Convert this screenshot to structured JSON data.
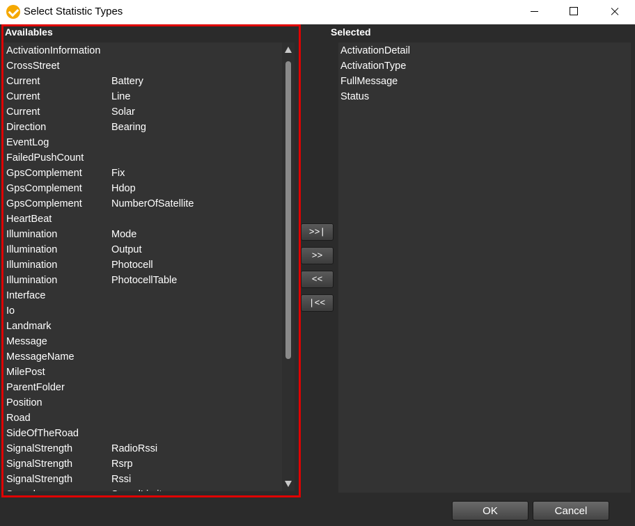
{
  "window": {
    "title": "Select Statistic Types"
  },
  "availables": {
    "label": "Availables",
    "items": [
      {
        "c1": "ActivationInformation",
        "c2": ""
      },
      {
        "c1": "CrossStreet",
        "c2": ""
      },
      {
        "c1": "Current",
        "c2": "Battery"
      },
      {
        "c1": "Current",
        "c2": "Line"
      },
      {
        "c1": "Current",
        "c2": "Solar"
      },
      {
        "c1": "Direction",
        "c2": "Bearing"
      },
      {
        "c1": "EventLog",
        "c2": ""
      },
      {
        "c1": "FailedPushCount",
        "c2": ""
      },
      {
        "c1": "GpsComplement",
        "c2": "Fix"
      },
      {
        "c1": "GpsComplement",
        "c2": "Hdop"
      },
      {
        "c1": "GpsComplement",
        "c2": "NumberOfSatellite"
      },
      {
        "c1": "HeartBeat",
        "c2": ""
      },
      {
        "c1": "Illumination",
        "c2": "Mode"
      },
      {
        "c1": "Illumination",
        "c2": "Output"
      },
      {
        "c1": "Illumination",
        "c2": "Photocell"
      },
      {
        "c1": "Illumination",
        "c2": "PhotocellTable"
      },
      {
        "c1": "Interface",
        "c2": ""
      },
      {
        "c1": "Io",
        "c2": ""
      },
      {
        "c1": "Landmark",
        "c2": ""
      },
      {
        "c1": "Message",
        "c2": ""
      },
      {
        "c1": "MessageName",
        "c2": ""
      },
      {
        "c1": "MilePost",
        "c2": ""
      },
      {
        "c1": "ParentFolder",
        "c2": ""
      },
      {
        "c1": "Position",
        "c2": ""
      },
      {
        "c1": "Road",
        "c2": ""
      },
      {
        "c1": "SideOfTheRoad",
        "c2": ""
      },
      {
        "c1": "SignalStrength",
        "c2": "RadioRssi"
      },
      {
        "c1": "SignalStrength",
        "c2": "Rsrp"
      },
      {
        "c1": "SignalStrength",
        "c2": "Rssi"
      },
      {
        "c1": "Speed",
        "c2": "SpeedLimit"
      }
    ]
  },
  "selected": {
    "label": "Selected",
    "items": [
      "ActivationDetail",
      "ActivationType",
      "FullMessage",
      "Status"
    ]
  },
  "move_buttons": {
    "add_all": ">>|",
    "add": ">>",
    "remove": "<<",
    "remove_all": "|<<"
  },
  "dialog_buttons": {
    "ok": "OK",
    "cancel": "Cancel"
  },
  "colors": {
    "highlight_border": "#e00000",
    "background": "#2b2b2b",
    "list_background": "#333333"
  }
}
